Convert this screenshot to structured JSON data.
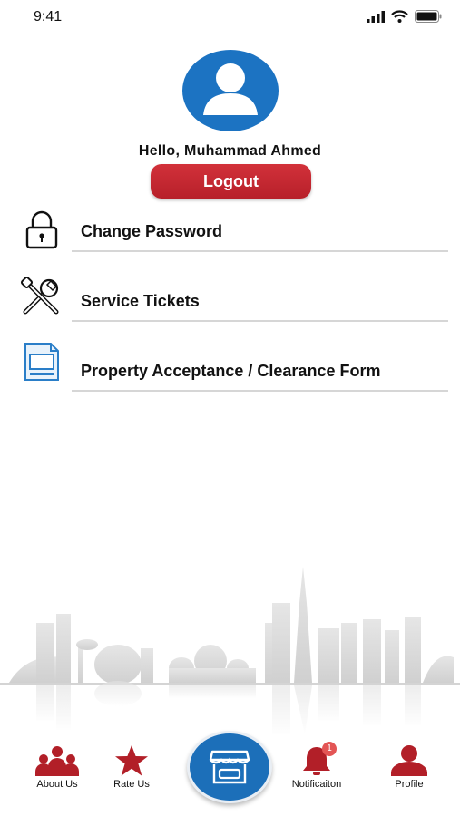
{
  "status_bar": {
    "time": "9:41"
  },
  "profile": {
    "greeting": "Hello, Muhammad Ahmed",
    "logout_label": "Logout"
  },
  "menu": {
    "items": [
      {
        "label": "Change Password",
        "icon": "lock-icon"
      },
      {
        "label": "Service Tickets",
        "icon": "tools-icon"
      },
      {
        "label": "Property Acceptance / Clearance Form",
        "icon": "form-document-icon"
      }
    ]
  },
  "bottom_nav": {
    "items": [
      {
        "label": "About Us",
        "icon": "group-icon"
      },
      {
        "label": "Rate Us",
        "icon": "star-icon"
      },
      {
        "label": "",
        "icon": "store-icon"
      },
      {
        "label": "Notificaiton",
        "icon": "bell-icon",
        "badge": "1"
      },
      {
        "label": "Profile",
        "icon": "person-icon"
      }
    ]
  },
  "colors": {
    "brand_red": "#c0262e",
    "brand_blue": "#1c6fb9",
    "badge_red": "#e35555"
  }
}
